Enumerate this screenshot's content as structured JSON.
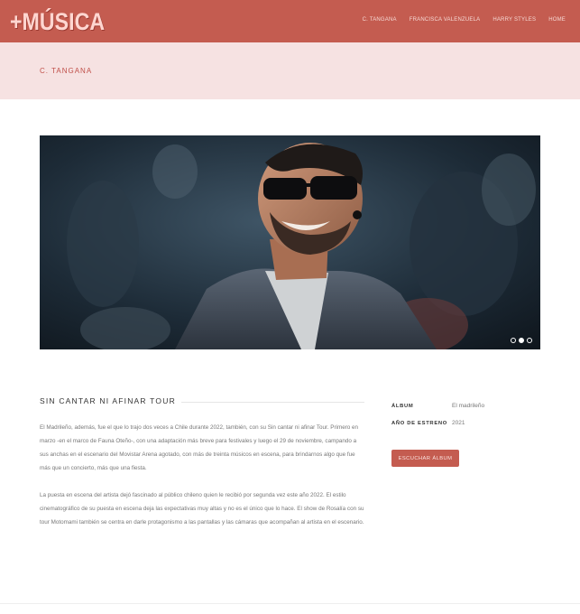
{
  "header": {
    "logo": "+MÚSICA",
    "nav": [
      "C. TANGANA",
      "FRANCISCA VALENZUELA",
      "HARRY STYLES",
      "HOME"
    ]
  },
  "band": {
    "title": "C. TANGANA"
  },
  "carousel": {
    "slides": 3,
    "active_index": 1
  },
  "content": {
    "section_title": "SIN CANTAR NI AFINAR TOUR",
    "paragraphs": [
      "El Madrileño, además, fue el que lo trajo dos veces a Chile durante 2022, también, con su Sin cantar ni afinar Tour. Primero en marzo -en el marco de Fauna Oteño-, con una adaptación más breve para festivales y luego el 29 de noviembre, campando a sus anchas en el escenario del Movistar Arena agotado, con más de treinta músicos en escena, para brindarnos algo que fue más que un concierto, más que una fiesta.",
      "La puesta en escena del artista dejó fascinado al público chileno quien le recibió por segunda vez este año 2022. El estilo cinematográfico de su puesta en escena deja las expectativas muy altas y no es el único que lo hace. El show de Rosalía con su tour Motomami también se centra en darle protagonismo a las pantallas y las cámaras que acompañan al artista en el escenario."
    ]
  },
  "meta": {
    "album_label": "ÁLBUM",
    "album_value": "El madrileño",
    "year_label": "AÑO DE ESTRENO",
    "year_value": "2021",
    "button_label": "ESCUCHAR ÁLBUM"
  },
  "colors": {
    "accent": "#c45c50",
    "band": "#f6e2e2"
  }
}
